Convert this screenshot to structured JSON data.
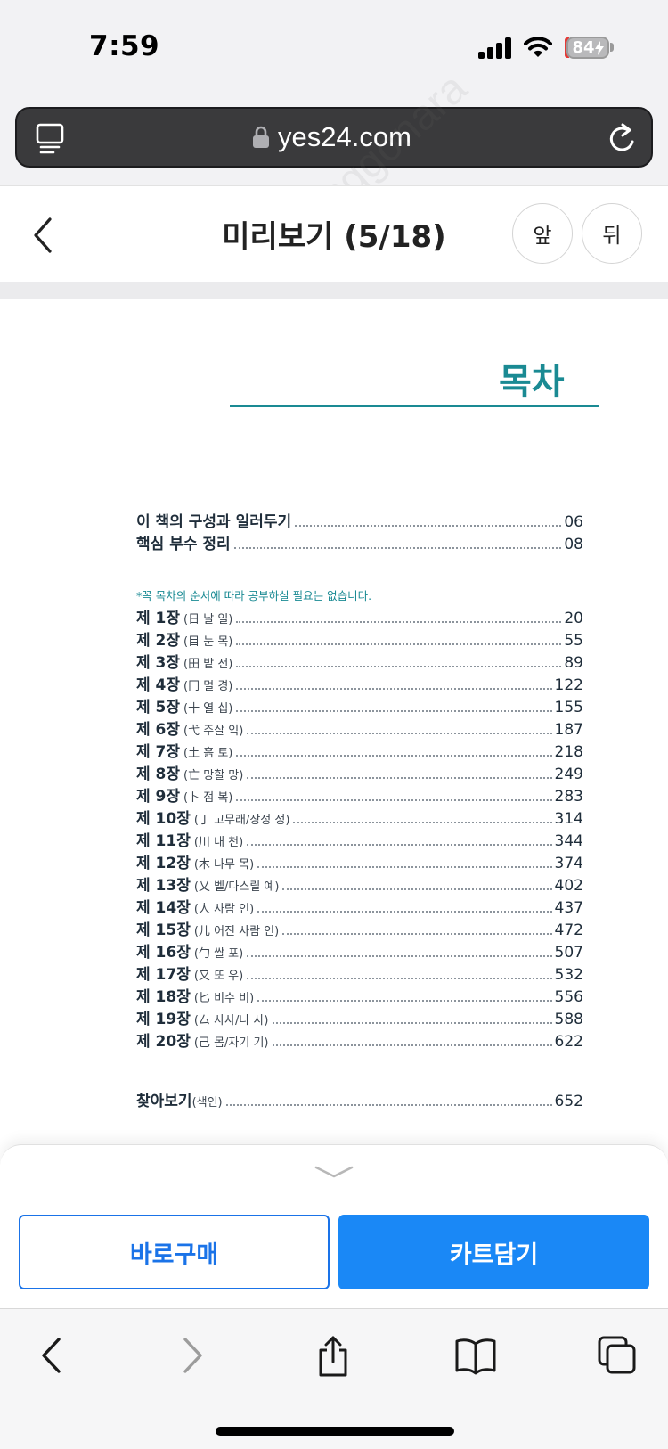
{
  "status_bar": {
    "time": "7:59",
    "battery": "84"
  },
  "address_bar": {
    "url": "yes24.com"
  },
  "header": {
    "title": "미리보기 (5/18)",
    "prev_label": "앞",
    "next_label": "뒤"
  },
  "book_page": {
    "heading": "목차",
    "intro_items": [
      {
        "label": "이 책의 구성과 일러두기",
        "page": "06"
      },
      {
        "label": "핵심 부수 정리",
        "page": "08"
      }
    ],
    "note": "*꼭 목차의 순서에 따라 공부하실 필요는 없습니다.",
    "chapters": [
      {
        "label": "제 1장",
        "sub": "(日 날 일)",
        "page": "20"
      },
      {
        "label": "제 2장",
        "sub": "(目 눈 목)",
        "page": "55"
      },
      {
        "label": "제 3장",
        "sub": "(田 밭 전)",
        "page": "89"
      },
      {
        "label": "제 4장",
        "sub": "(冂 멀 경)",
        "page": "122"
      },
      {
        "label": "제 5장",
        "sub": "(十 열 십)",
        "page": "155"
      },
      {
        "label": "제 6장",
        "sub": "(弋 주살 익)",
        "page": "187"
      },
      {
        "label": "제 7장",
        "sub": "(土 흙 토)",
        "page": "218"
      },
      {
        "label": "제 8장",
        "sub": "(亡 망할 망)",
        "page": "249"
      },
      {
        "label": "제 9장",
        "sub": "(卜 점 복)",
        "page": "283"
      },
      {
        "label": "제 10장",
        "sub": "(丁 고무래/장정 정)",
        "page": "314"
      },
      {
        "label": "제 11장",
        "sub": "(川 내 천)",
        "page": "344"
      },
      {
        "label": "제 12장",
        "sub": "(木 나무 목)",
        "page": "374"
      },
      {
        "label": "제 13장",
        "sub": "(乂 벨/다스릴 예)",
        "page": "402"
      },
      {
        "label": "제 14장",
        "sub": "(人 사람 인)",
        "page": "437"
      },
      {
        "label": "제 15장",
        "sub": "(儿 어진 사람 인)",
        "page": "472"
      },
      {
        "label": "제 16장",
        "sub": "(勹 쌀 포)",
        "page": "507"
      },
      {
        "label": "제 17장",
        "sub": "(又 또 우)",
        "page": "532"
      },
      {
        "label": "제 18장",
        "sub": "(匕 비수 비)",
        "page": "556"
      },
      {
        "label": "제 19장",
        "sub": "(厶 사사/나 사)",
        "page": "588"
      },
      {
        "label": "제 20장",
        "sub": "(己 몸/자기 기)",
        "page": "622"
      }
    ],
    "index_item": {
      "label": "찾아보기",
      "sub": "(색인)",
      "page": "652"
    }
  },
  "actions": {
    "buy_label": "바로구매",
    "cart_label": "카트담기"
  },
  "watermark": "joonggonara",
  "colors": {
    "accent_teal": "#1a8a93",
    "button_blue": "#1a88f6",
    "outline_blue": "#1a73e8"
  }
}
